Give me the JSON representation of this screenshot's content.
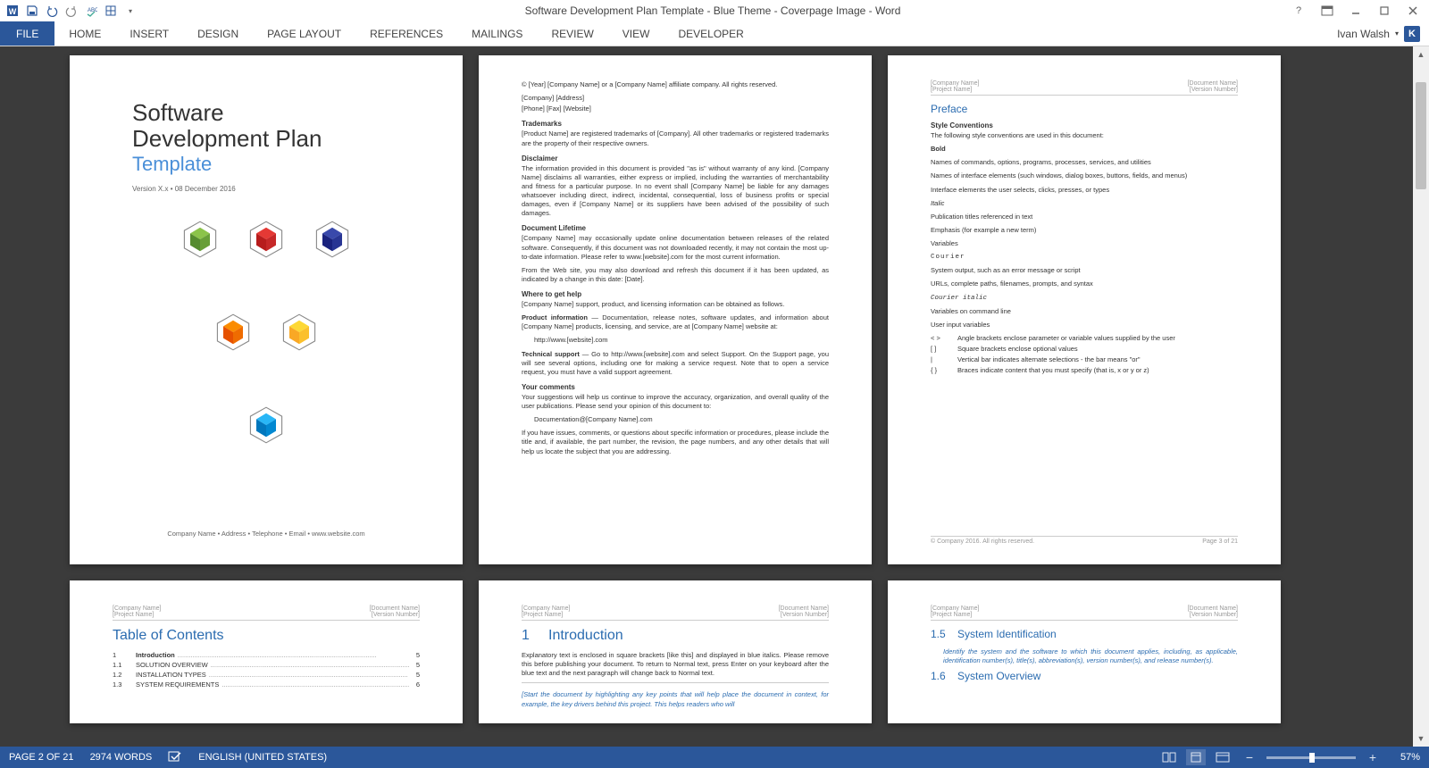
{
  "title": "Software Development Plan Template - Blue Theme - Coverpage Image - Word",
  "user": {
    "name": "Ivan Walsh",
    "initial": "K"
  },
  "tabs": {
    "file": "FILE",
    "items": [
      "HOME",
      "INSERT",
      "DESIGN",
      "PAGE LAYOUT",
      "REFERENCES",
      "MAILINGS",
      "REVIEW",
      "VIEW",
      "DEVELOPER"
    ]
  },
  "status": {
    "page": "PAGE 2 OF 21",
    "words": "2974 WORDS",
    "lang": "ENGLISH (UNITED STATES)",
    "zoom": "57%"
  },
  "cover": {
    "line1": "Software",
    "line2": "Development Plan",
    "template": "Template",
    "meta": "Version X.x • 08 December 2016",
    "footer": "Company Name • Address • Telephone • Email • www.website.com"
  },
  "p2": {
    "copyright": "© [Year] [Company Name] or a [Company Name] affiliate company. All rights reserved.",
    "addr": "[Company] [Address]",
    "contact": "[Phone] [Fax] [Website]",
    "trademarks_h": "Trademarks",
    "trademarks": "[Product Name] are registered trademarks of [Company]. All other trademarks or registered trademarks are the property of their respective owners.",
    "disclaimer_h": "Disclaimer",
    "disclaimer": "The information provided in this document is provided \"as is\" without warranty of any kind. [Company Name] disclaims all warranties, either express or implied, including the warranties of merchantability and fitness for a particular purpose. In no event shall [Company Name] be liable for any damages whatsoever including direct, indirect, incidental, consequential, loss of business profits or special damages, even if [Company Name] or its suppliers have been advised of the possibility of such damages.",
    "lifetime_h": "Document Lifetime",
    "lifetime1": "[Company Name] may occasionally update online documentation between releases of the related software. Consequently, if this document was not downloaded recently, it may not contain the most up-to-date information. Please refer to www.[website].com for the most current information.",
    "lifetime2": "From the Web site, you may also download and refresh this document if it has been updated, as indicated by a change in this date: [Date].",
    "help_h": "Where to get help",
    "help1": "[Company Name] support, product, and licensing information can be obtained as follows.",
    "prodinfo_b": "Product information",
    "prodinfo": " — Documentation, release notes, software updates, and information about [Company Name] products, licensing, and service, are at [Company Name] website at:",
    "prodinfo_url": "http://www.[website].com",
    "techsup_b": "Technical support",
    "techsup": " — Go to http://www.[website].com and select Support. On the Support page, you will see several options, including one for making a service request. Note that to open a service request, you must have a valid support agreement.",
    "comments_h": "Your comments",
    "comments1": "Your suggestions will help us continue to improve the accuracy, organization, and overall quality of the user publications. Please send your opinion of this document to:",
    "comments_email": "Documentation@[Company Name].com",
    "comments2": "If you have issues, comments, or questions about specific information or procedures, please include the title and, if available, the part number, the revision, the page numbers, and any other details that will help us locate the subject that you are addressing."
  },
  "p3": {
    "preface": "Preface",
    "styleconv": "Style Conventions",
    "intro": "The following style conventions are used in this document:",
    "bold": "Bold",
    "bold1": "Names of commands, options, programs, processes, services, and utilities",
    "bold2": "Names of interface elements (such windows, dialog boxes, buttons, fields, and menus)",
    "bold3": "Interface elements the user selects, clicks, presses, or types",
    "italic": "Italic",
    "italic1": "Publication titles referenced in text",
    "italic2": "Emphasis (for example a new term)",
    "italic3": "Variables",
    "courier": "Courier",
    "courier1": "System output, such as an error message or script",
    "courier2": "URLs, complete paths, filenames, prompts, and syntax",
    "courieri": "Courier italic",
    "courieri1": "Variables on command line",
    "courieri2": "User input variables",
    "tb": [
      {
        "sym": "< >",
        "txt": "Angle brackets enclose parameter or variable values supplied by the user"
      },
      {
        "sym": "[ ]",
        "txt": "Square brackets enclose optional values"
      },
      {
        "sym": "|",
        "txt": "Vertical bar indicates alternate selections - the bar means \"or\""
      },
      {
        "sym": "{ }",
        "txt": "Braces indicate content that you must specify (that is, x or y or z)"
      }
    ],
    "ftl": "© Company 2016. All rights reserved.",
    "ftr": "Page 3 of 21"
  },
  "hdr": {
    "tl": "[Company Name]",
    "tr": "[Document Name]",
    "bl": "[Project Name]",
    "br": "[Version Number]"
  },
  "toc": {
    "title": "Table of Contents",
    "r0": {
      "n": "1",
      "t": "Introduction",
      "p": "5"
    },
    "r1": {
      "n": "1.1",
      "t": "SOLUTION OVERVIEW",
      "p": "5"
    },
    "r2": {
      "n": "1.2",
      "t": "INSTALLATION TYPES",
      "p": "5"
    },
    "r3": {
      "n": "1.3",
      "t": "SYSTEM REQUIREMENTS",
      "p": "6"
    }
  },
  "p5": {
    "num": "1",
    "title": "Introduction",
    "exp": "Explanatory text is enclosed in square brackets [like this] and displayed in blue italics. Please remove this before publishing your document. To return to Normal text, press Enter on your keyboard after the blue text and the next paragraph will change back to Normal text.",
    "start": "[Start the document by highlighting any key points that will help place the document in context, for example, the key drivers behind this project. This helps readers who will"
  },
  "p6": {
    "s1n": "1.5",
    "s1t": "System Identification",
    "s1b": "Identify the system and the software to which this document applies, including, as applicable, identification number(s), title(s), abbreviation(s), version number(s), and release number(s).",
    "s2n": "1.6",
    "s2t": "System Overview"
  }
}
